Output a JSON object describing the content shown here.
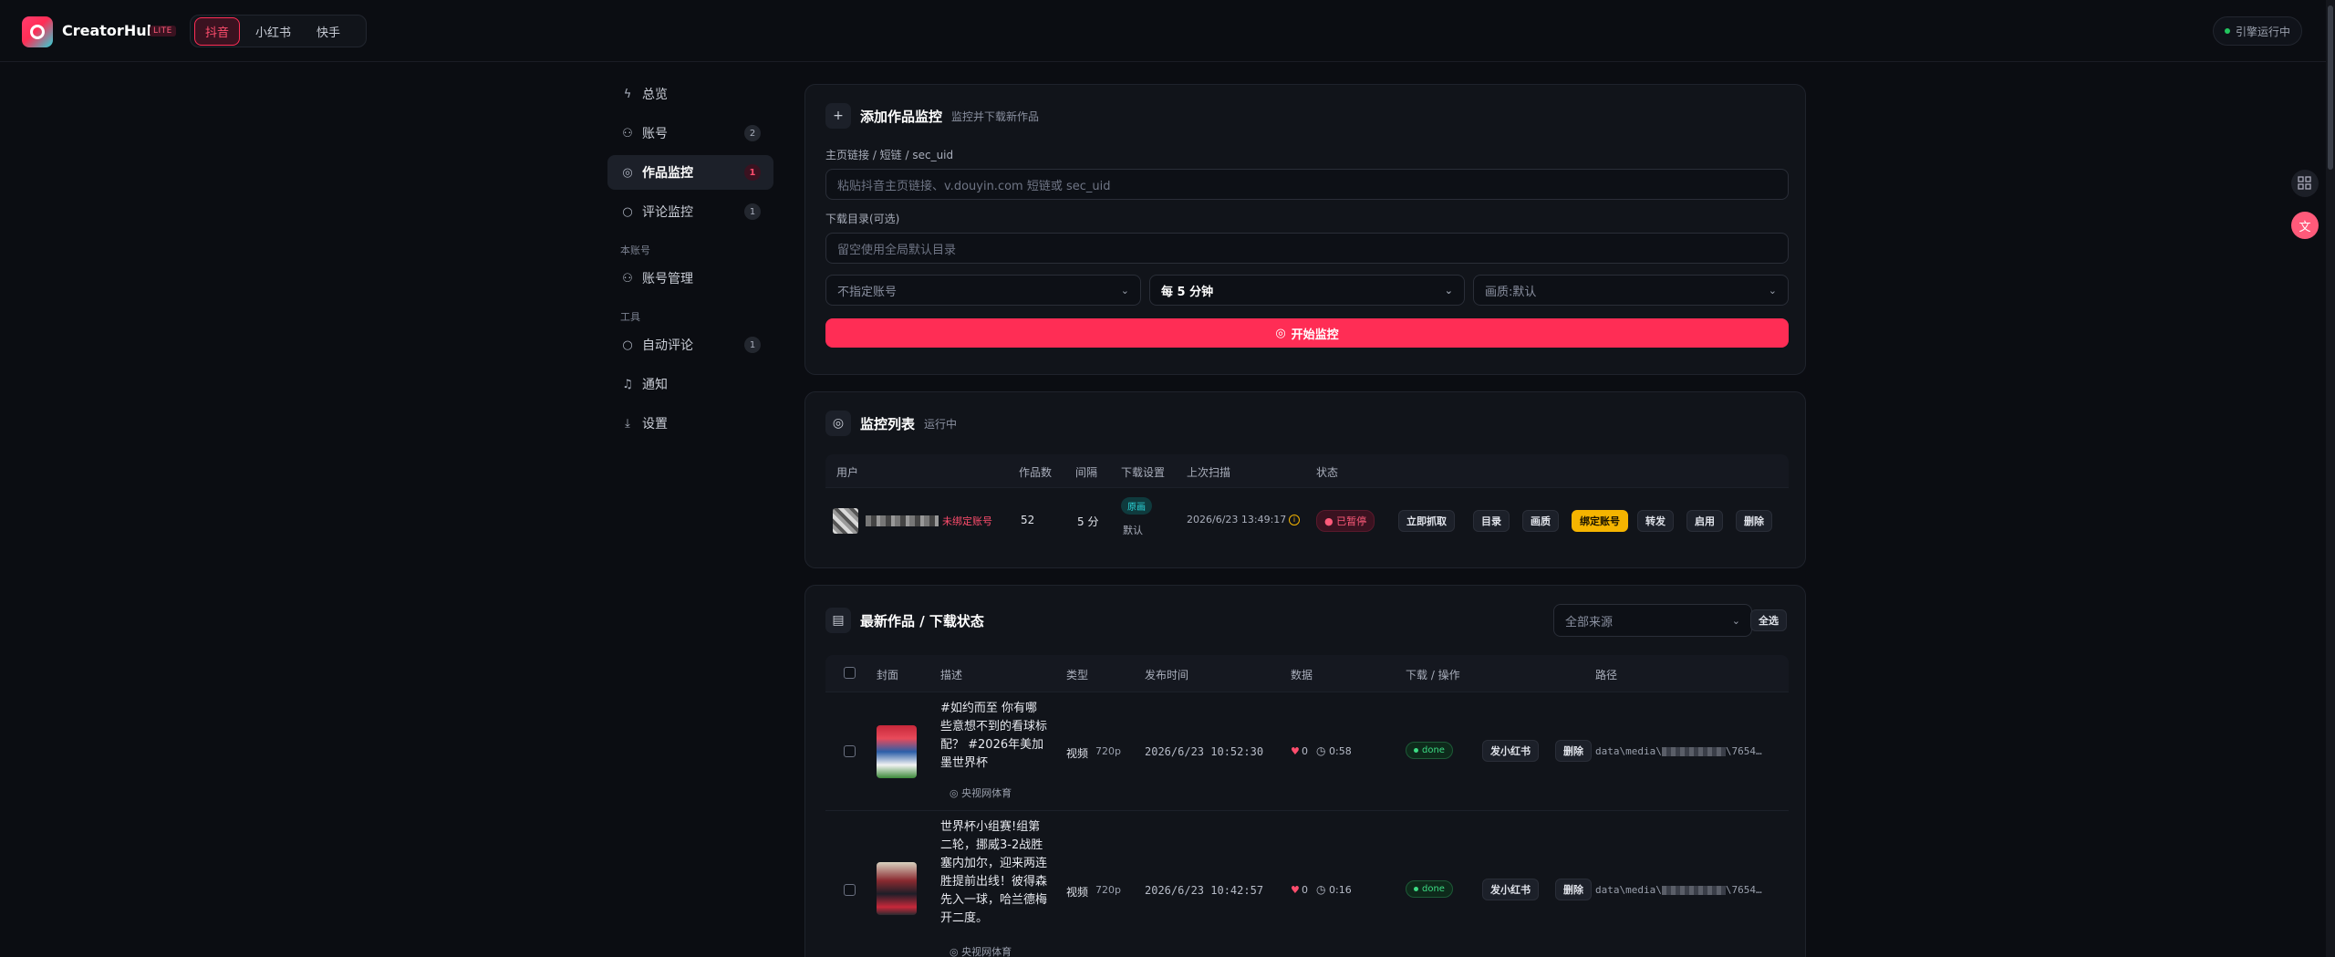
{
  "app": {
    "brand": "CreatorHub",
    "brand_badge": "LITE",
    "platforms": [
      "抖音",
      "小红书",
      "快手"
    ],
    "engine_status": "引擎运行中"
  },
  "sidebar": {
    "items": [
      {
        "label": "总览",
        "icon": "bolt-icon"
      },
      {
        "label": "账号",
        "icon": "user-icon",
        "count": "2"
      },
      {
        "label": "作品监控",
        "icon": "target-icon",
        "count": "1"
      },
      {
        "label": "评论监控",
        "icon": "comment-icon",
        "count": "1"
      }
    ],
    "section_account": "本账号",
    "account_items": [
      {
        "label": "账号管理",
        "icon": "user-icon"
      }
    ],
    "section_tools": "工具",
    "tool_items": [
      {
        "label": "自动评论",
        "icon": "comment-icon",
        "count": "1"
      },
      {
        "label": "通知",
        "icon": "bell-icon"
      },
      {
        "label": "设置",
        "icon": "download-icon"
      }
    ]
  },
  "add_monitor": {
    "title": "添加作品监控",
    "subtitle": "监控并下载新作品",
    "url_label": "主页链接 / 短链 / sec_uid",
    "url_placeholder": "粘贴抖音主页链接、v.douyin.com 短链或 sec_uid",
    "dir_label": "下载目录(可选)",
    "dir_placeholder": "留空使用全局默认目录",
    "account_select": "不指定账号",
    "interval_select": "每 5 分钟",
    "quality_select": "画质:默认",
    "start_button": "开始监控"
  },
  "monitor_list": {
    "title": "监控列表",
    "subtitle": "运行中",
    "columns": [
      "用户",
      "作品数",
      "间隔",
      "下载设置",
      "上次扫描",
      "状态"
    ],
    "row": {
      "unbound_tag": "未绑定账号",
      "works_count": "52",
      "interval": "5 分",
      "download_tag": "原画",
      "download_default": "默认",
      "last_scan": "2026/6/23 13:49:17",
      "status": "已暂停",
      "actions": [
        "立即抓取",
        "目录",
        "画质",
        "绑定账号",
        "转发",
        "启用",
        "删除"
      ]
    }
  },
  "works": {
    "title": "最新作品 / 下载状态",
    "source_select": "全部来源",
    "select_all": "全选",
    "columns": [
      "封面",
      "描述",
      "类型",
      "发布时间",
      "数据",
      "下载 / 操作",
      "路径"
    ],
    "rows": [
      {
        "desc": "#如约而至 你有哪些意想不到的看球标配？ #2026年美加墨世界杯",
        "source": "央视网体育",
        "type": "视频",
        "quality": "720p",
        "time": "2026/6/23 10:52:30",
        "likes": "0",
        "duration": "0:58",
        "status": "done",
        "action1": "发小红书",
        "action2": "删除",
        "path_prefix": "data\\media\\",
        "path_suffix": "\\7654…"
      },
      {
        "desc": "世界杯小组赛!组第二轮，挪威3-2战胜塞内加尔，迎来两连胜提前出线！彼得森先入一球，哈兰德梅开二度。",
        "source": "央视网体育",
        "type": "视频",
        "quality": "720p",
        "time": "2026/6/23 10:42:57",
        "likes": "0",
        "duration": "0:16",
        "status": "done",
        "action1": "发小红书",
        "action2": "删除",
        "path_prefix": "data\\media\\",
        "path_suffix": "\\7654…"
      }
    ]
  },
  "colors": {
    "accent": "#ff2d55",
    "teal": "#2bd4d9",
    "yellow": "#f5b400",
    "green": "#3ddc84"
  }
}
